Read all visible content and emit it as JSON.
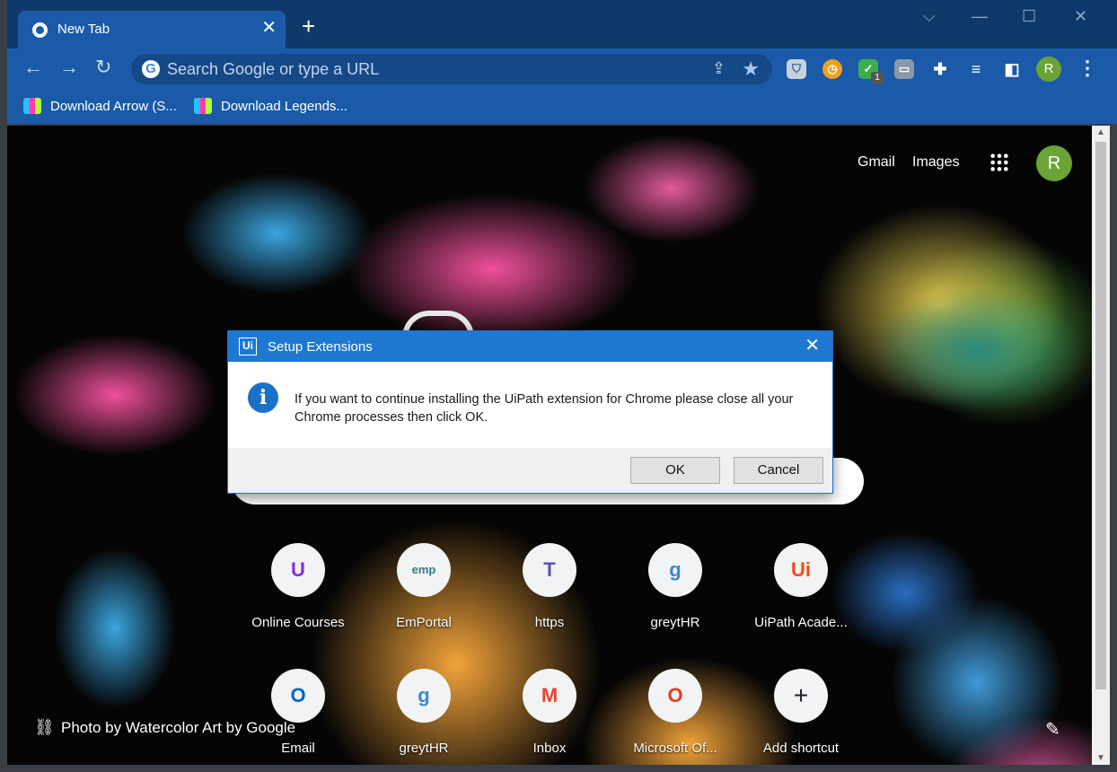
{
  "browser": {
    "tab_title": "New Tab",
    "tab_close": "✕",
    "new_tab": "+",
    "window_controls": {
      "tab_search": "⌵",
      "minimize": "—",
      "maximize": "☐",
      "close": "✕"
    },
    "omnibox_placeholder": "Search Google or type a URL",
    "google_letter": "G",
    "profile_initial": "R",
    "extensions": [
      {
        "name": "shield-extension",
        "badge": ""
      },
      {
        "name": "clock-extension",
        "badge": ""
      },
      {
        "name": "vpn-extension",
        "badge": "1"
      },
      {
        "name": "screen-extension",
        "badge": ""
      }
    ],
    "bookmarks": [
      {
        "label": "Download Arrow (S..."
      },
      {
        "label": "Download Legends..."
      }
    ]
  },
  "page": {
    "top_links": {
      "gmail": "Gmail",
      "images": "Images"
    },
    "avatar_initial": "R",
    "shortcuts_row1": [
      {
        "label": "Online Courses",
        "icon": "U",
        "color": "#8a2be2"
      },
      {
        "label": "EmPortal",
        "icon": "emp",
        "color": "#3a7a8a"
      },
      {
        "label": "https",
        "icon": "T",
        "color": "#5558af"
      },
      {
        "label": "greytHR",
        "icon": "g",
        "color": "#3a8ad0"
      },
      {
        "label": "UiPath Acade...",
        "icon": "Ui",
        "color": "#fa4616"
      }
    ],
    "shortcuts_row2": [
      {
        "label": "Email",
        "icon": "O",
        "color": "#0a64c8"
      },
      {
        "label": "greytHR",
        "icon": "g",
        "color": "#3a8ad0"
      },
      {
        "label": "Inbox",
        "icon": "M",
        "color": "#ea4335"
      },
      {
        "label": "Microsoft Of...",
        "icon": "O",
        "color": "#e3401e"
      },
      {
        "label": "Add shortcut",
        "icon": "+",
        "color": "#202124"
      }
    ],
    "attribution": "Photo by Watercolor Art by Google"
  },
  "dialog": {
    "icon_text": "Ui",
    "title": "Setup Extensions",
    "close": "✕",
    "info_glyph": "i",
    "message": "If you want to continue installing the UiPath extension for Chrome please close all your Chrome processes then click OK.",
    "ok_label": "OK",
    "cancel_label": "Cancel"
  }
}
